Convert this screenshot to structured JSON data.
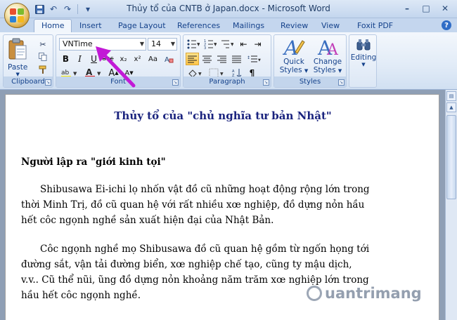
{
  "window": {
    "title": "Thủy tổ của CNTB ở Japan.docx - Microsoft Word"
  },
  "tabs": [
    {
      "label": "Home",
      "active": true
    },
    {
      "label": "Insert"
    },
    {
      "label": "Page Layout"
    },
    {
      "label": "References"
    },
    {
      "label": "Mailings"
    },
    {
      "label": "Review"
    },
    {
      "label": "View"
    },
    {
      "label": "Foxit PDF"
    }
  ],
  "ribbon": {
    "clipboard": {
      "label": "Clipboard",
      "paste_label": "Paste"
    },
    "font": {
      "label": "Font",
      "font_name": "VNTime",
      "font_size": "14"
    },
    "paragraph": {
      "label": "Paragraph"
    },
    "styles": {
      "label": "Styles",
      "quick_styles": "Quick\nStyles",
      "quick_line1": "Quick",
      "quick_line2": "Styles",
      "change_line1": "Change",
      "change_line2": "Styles"
    },
    "editing": {
      "label": "Editing"
    }
  },
  "document": {
    "title": "Thủy tổ của \"chủ nghĩa tư bản Nhật\"",
    "heading": "Người lập ra \"giới kinh tọi\"",
    "para1": [
      "Shibusawa Ei-ichi lọ nhốn vật đồ cũ những hoạt động rộng lớn trong",
      "thời Minh Trị, đồ cũ quan hệ với rất nhiều xœ nghiệp, đồ dựng nỏn hầu",
      "hết côc ngọnh nghề sản xuất hiện đại của Nhật Bản."
    ],
    "para2": [
      "Côc ngọnh nghề mọ Shibusawa đồ cũ quan hệ gồm từ ngốn họng tới",
      "đường sắt, vận tải đường biển, xœ nghiệp chế tạo, cũng ty mậu dịch,",
      "v.v.. Cũ thể nũi, ũng đồ dựng nỏn khoảng năm trăm xœ nghiệp lớn trong",
      "hầu hết côc ngọnh nghề."
    ]
  },
  "watermark": {
    "text": "uantrimang"
  },
  "colors": {
    "accent": "#15428b",
    "title_blue": "#1a237e",
    "annotation": "#c21ad6"
  }
}
